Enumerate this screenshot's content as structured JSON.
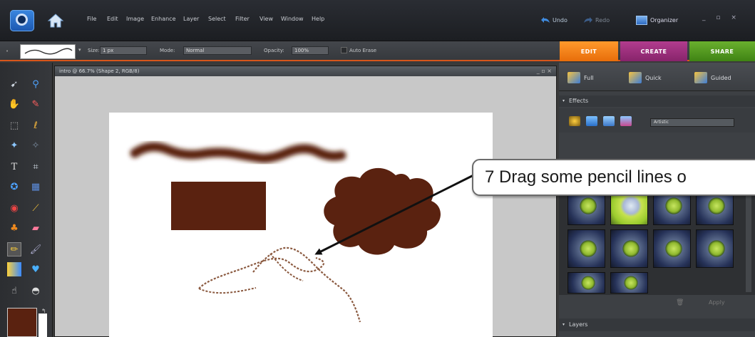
{
  "menubar": {
    "items": [
      "File",
      "Edit",
      "Image",
      "Enhance",
      "Layer",
      "Select",
      "Filter",
      "View",
      "Window",
      "Help"
    ],
    "undo_label": "Undo",
    "redo_label": "Redo",
    "organizer_label": "Organizer",
    "window_controls": "_ ▫ ×"
  },
  "options_bar": {
    "size_label": "Size:",
    "size_value": "1 px",
    "mode_label": "Mode:",
    "mode_value": "Normal",
    "opacity_label": "Opacity:",
    "opacity_value": "100%",
    "auto_erase_label": "Auto Erase"
  },
  "mode_tabs": {
    "edit": "EDIT",
    "create": "CREATE",
    "share": "SHARE"
  },
  "document": {
    "title": "intro @ 66.7% (Shape 2, RGB/8)",
    "controls": "_ ▫ ×"
  },
  "panel": {
    "modes": [
      "Full",
      "Quick",
      "Guided"
    ],
    "effects_header": "Effects",
    "effects_dropdown": "Artistic",
    "apply_label": "Apply",
    "layers_header": "Layers"
  },
  "colors": {
    "foreground": "#5a2210",
    "background": "#ffffff",
    "accent_edit": "#f08a1e",
    "accent_create": "#a0307c",
    "accent_share": "#56a021"
  },
  "callout": {
    "text": "7  Drag some pencil lines o"
  }
}
